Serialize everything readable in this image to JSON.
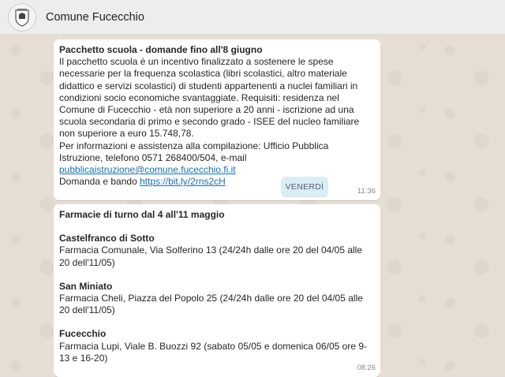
{
  "header": {
    "title": "Comune Fucecchio"
  },
  "messages": [
    {
      "title": "Pacchetto scuola - domande fino all'8 giugno",
      "body": "Il pacchetto scuola è un incentivo finalizzato a sostenere le spese necessarie per la frequenza scolastica (libri scolastici, altro materiale didattico e servizi scolastici) di studenti appartenenti a nuclei familiari in condizioni socio economiche svantaggiate. Requisiti: residenza nel Comune di Fucecchio - età non superiore a 20 anni - iscrizione ad una scuola secondaria di primo e secondo grado - ISEE del nucleo familiare non superiore a euro 15.748,78.",
      "contact_text": "Per informazioni e assistenza alla compilazione: Ufficio Pubblica Istruzione, telefono 0571 268400/504, e-mail ",
      "email": "pubblicaistruzione@comune.fucecchio.fi.it",
      "bando_text": "Domanda e bando ",
      "bando_link": "https://bit.ly/2rns2cH",
      "time": "11:36"
    },
    {
      "title": "Farmacie di turno dal 4 all'11 maggio",
      "entries": [
        {
          "place": "Castelfranco di Sotto",
          "detail": "Farmacia Comunale, Via Solferino 13 (24/24h dalle ore 20 del 04/05 alle 20 dell'11/05)"
        },
        {
          "place": "San Miniato",
          "detail": "Farmacia Cheli, Piazza del Popolo 25 (24/24h dalle ore 20 del 04/05 alle 20 dell'11/05)"
        },
        {
          "place": "Fucecchio",
          "detail": "Farmacia Lupi, Viale B. Buozzi 92 (sabato 05/05 e domenica 06/05 ore 9-13 e 16-20)"
        }
      ],
      "time": "08:26"
    }
  ],
  "day_separator": "VENERDÌ",
  "icons": {
    "avatar": "crest-icon"
  }
}
